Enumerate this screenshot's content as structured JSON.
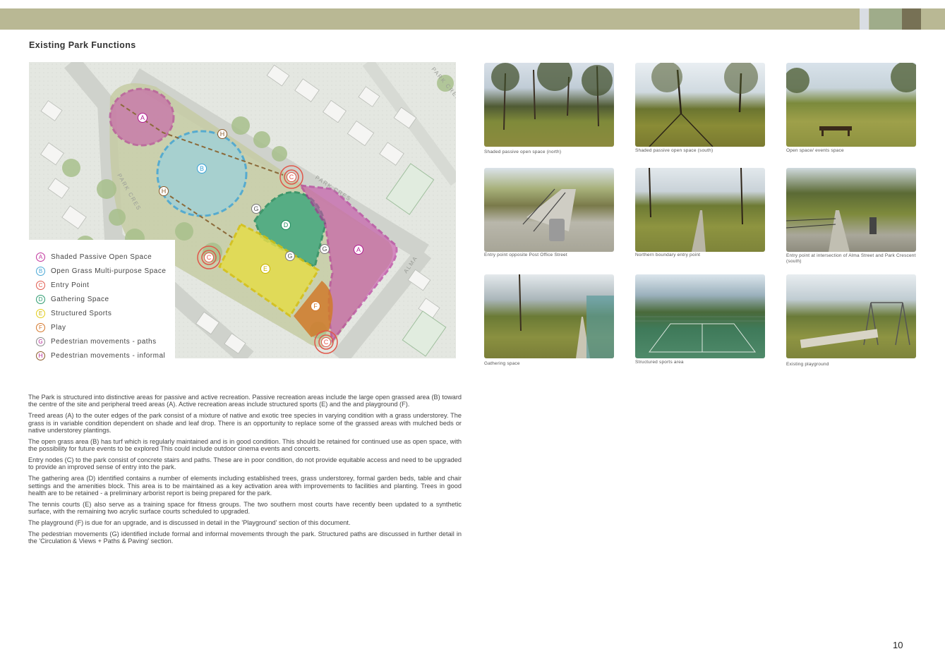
{
  "header": {
    "colors": {
      "band": "#b9b894",
      "accent_light": "#d9dde3",
      "accent_mid": "#9fac8a",
      "accent_dark": "#777155"
    }
  },
  "title": "Existing Park Functions",
  "map": {
    "street_labels": [
      "PARK CRES",
      "PARK CRES",
      "ALMA",
      "PARK CRES"
    ],
    "zone_markers": [
      "A",
      "A",
      "B",
      "C",
      "C",
      "C",
      "D",
      "E",
      "F",
      "G",
      "G",
      "G",
      "H",
      "H"
    ]
  },
  "legend": [
    {
      "letter": "A",
      "label": "Shaded Passive Open Space",
      "color": "#c0339c"
    },
    {
      "letter": "B",
      "label": "Open Grass Multi-purpose Space",
      "color": "#4aa8d6"
    },
    {
      "letter": "C",
      "label": "Entry Point",
      "color": "#e0574a"
    },
    {
      "letter": "D",
      "label": "Gathering Space",
      "color": "#2b9a6e"
    },
    {
      "letter": "E",
      "label": "Structured Sports",
      "color": "#e3cd14"
    },
    {
      "letter": "F",
      "label": "Play",
      "color": "#d4762a"
    },
    {
      "letter": "G",
      "label": "Pedestrian movements - paths",
      "color": "#8a8a8a"
    },
    {
      "letter": "H",
      "label": "Pedestrian movements - informal",
      "color": "#8a5a2a"
    }
  ],
  "photos": [
    {
      "caption": "Shaded passive open space (north)"
    },
    {
      "caption": "Shaded passive open space (south)"
    },
    {
      "caption": "Open space/ events space"
    },
    {
      "caption": "Entry point opposite Post Office Street"
    },
    {
      "caption": "Northern boundary entry point"
    },
    {
      "caption": "Entry point at intersection of Alma Street and Park Crescent (south)"
    },
    {
      "caption": "Gathering space"
    },
    {
      "caption": "Structured sports area"
    },
    {
      "caption": "Existing playground"
    }
  ],
  "body": {
    "paragraphs": [
      "The Park is structured into distinctive areas for passive and active recreation. Passive recreation areas include the large open grassed area (B) toward the centre of the site and peripheral treed areas (A). Active recreation areas include structured sports (E) and the and playground (F).",
      "Treed areas (A) to the outer edges of the park consist of a mixture of native and exotic tree species in varying condition with a grass understorey. The grass is in variable condition dependent on shade and leaf drop. There is an opportunity to replace some of the grassed areas with mulched beds or native understorey plantings.",
      "The open grass area (B) has turf which is regularly maintained and is in good condition. This should be retained for continued use as open space, with the possibility for future events to be explored This could include outdoor cinema events and concerts.",
      "Entry nodes (C) to the park consist of concrete stairs and paths. These are in poor condition, do not provide equitable access and need to be upgraded to provide an improved sense of entry into the park.",
      "The gathering area (D) identified contains a number of elements including established trees, grass understorey, formal garden beds, table and chair settings and the amenities block. This area is to be maintained as a key activation area with improvements to facilities and planting. Trees in good health are to be retained - a preliminary arborist report is being prepared for the park.",
      "The tennis courts (E) also serve as a training space for fitness groups. The two southern most courts have recently been updated to a synthetic surface, with the remaining two acrylic surface courts scheduled to upgraded.",
      "The playground (F) is due for an upgrade, and is discussed in detail in the 'Playground' section of this document.",
      "The pedestrian movements (G) identified include formal and informal movements through the park. Structured paths are discussed in further detail in the 'Circulation & Views + Paths & Paving' section."
    ]
  },
  "page_number": "10"
}
